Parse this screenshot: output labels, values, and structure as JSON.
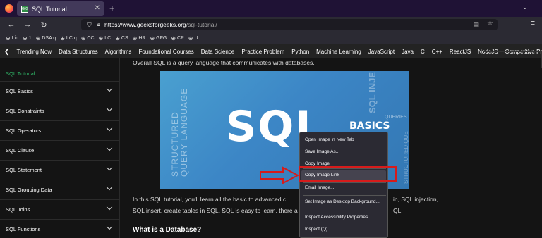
{
  "browser": {
    "tab_title": "SQL Tutorial",
    "tab_favicon": "GfG",
    "new_tab": "+",
    "close_tab": "✕",
    "url_host": "https://www.geeksforgeeks.org",
    "url_path": "/sql-tutorial/"
  },
  "bookmarks": [
    "Lin",
    "1",
    "DSA q",
    "LC q",
    "CC",
    "LC",
    "CS",
    "HR",
    "GFG",
    "CP",
    "U"
  ],
  "topnav": [
    "Trending Now",
    "Data Structures",
    "Algorithms",
    "Foundational Courses",
    "Data Science",
    "Practice Problem",
    "Python",
    "Machine Learning",
    "JavaScript",
    "Java",
    "C",
    "C++",
    "ReactJS",
    "NodeJS",
    "Competitive Programm"
  ],
  "sidebar": {
    "active": "SQL Tutorial",
    "items": [
      "SQL Basics",
      "SQL Constraints",
      "SQL Operators",
      "SQL Clause",
      "SQL Statement",
      "SQL Grouping Data",
      "SQL Joins",
      "SQL Functions"
    ]
  },
  "main": {
    "intro": "Overall SQL is a query language that communicates with databases.",
    "hero": {
      "big": "SQL",
      "basics": "BASICS",
      "vertical_left": [
        "STRUCTURED",
        "QUERY LANGUAGE"
      ],
      "vertical_right": "SQL INJE",
      "queries": "QUERIES",
      "vertical_far_right": "STRUCTURED QUE",
      "ver": "VER"
    },
    "para_line1": "In this SQL tutorial, you'll learn all the basic to advanced c",
    "para_line2": "SQL insert, create tables in SQL. SQL is easy to learn, there a",
    "para_tail1": "in, SQL injection,",
    "para_tail2": "QL.",
    "heading": "What is a Database?"
  },
  "context_menu": {
    "items": [
      "Open Image in New Tab",
      "Save Image As...",
      "Copy Image",
      "Copy Image Link",
      "Email Image...",
      "Set Image as Desktop Background...",
      "Inspect Accessibility Properties",
      "Inspect (Q)"
    ],
    "highlighted": "Copy Image Link"
  },
  "colors": {
    "accent_green": "#2fb466",
    "annotation_red": "#d61b1b",
    "titlebar": "#1f1235"
  }
}
